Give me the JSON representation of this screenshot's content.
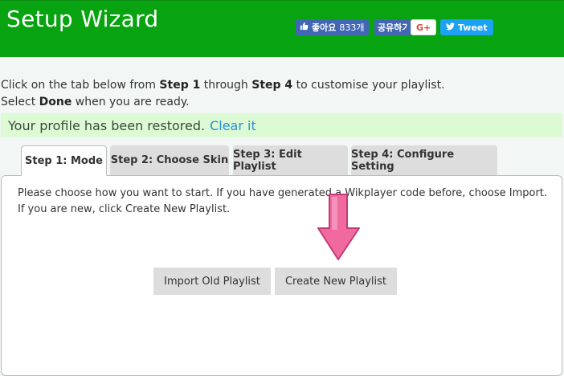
{
  "header": {
    "title": "Setup Wizard",
    "social": {
      "like_label": "좋아요",
      "like_count": "833개",
      "share_label": "공유하기",
      "gplus_label": "G+",
      "tweet_label": "Tweet"
    }
  },
  "intro": {
    "line1_pre": "Click on the tab below from ",
    "line1_b1": "Step 1",
    "line1_mid": " through ",
    "line1_b2": "Step 4",
    "line1_post": " to customise your playlist.",
    "line2_pre": "Select ",
    "line2_b": "Done",
    "line2_post": " when you are ready."
  },
  "notice": {
    "text": "Your profile has been restored.",
    "link": "Clear it"
  },
  "tabs": [
    {
      "label": "Step 1: Mode"
    },
    {
      "label": "Step 2: Choose Skin"
    },
    {
      "label": "Step 3: Edit Playlist"
    },
    {
      "label": "Step 4: Configure Setting"
    }
  ],
  "panel": {
    "line1": "Please choose how you want to start. If you have generated a Wikplayer code before, choose Import.",
    "line2": "If you are new, click Create New Playlist."
  },
  "buttons": {
    "import": "Import Old Playlist",
    "create": "Create New Playlist"
  },
  "colors": {
    "header": "#07a310",
    "notice_bg": "#dcfad4",
    "link": "#2b8fd6",
    "arrow": "#f06aa0"
  }
}
